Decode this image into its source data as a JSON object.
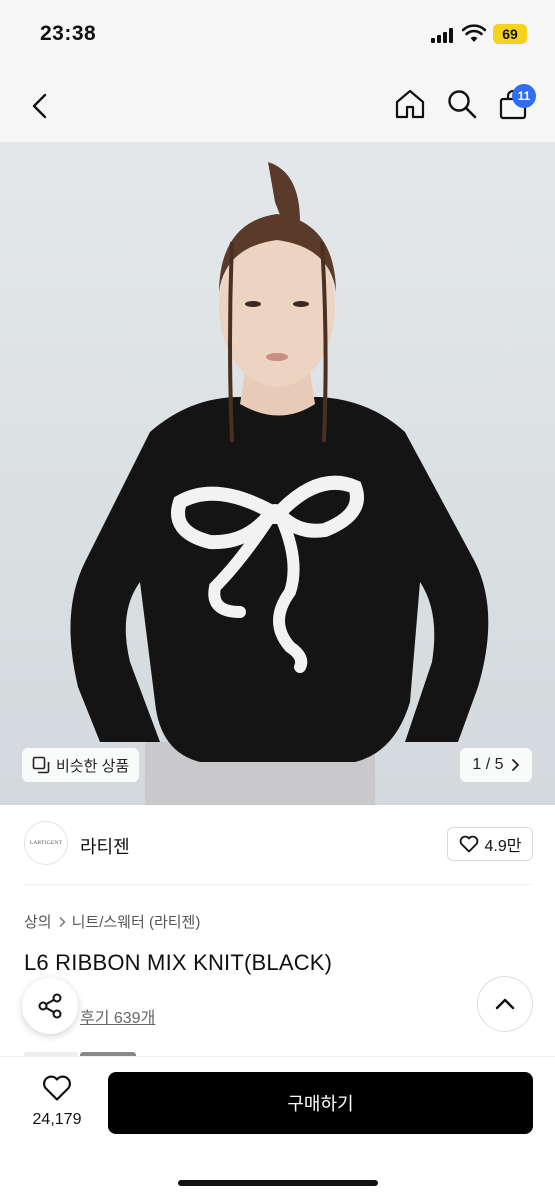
{
  "status_bar": {
    "time": "23:38",
    "battery": "69"
  },
  "nav": {
    "cart_count": "11"
  },
  "hero": {
    "similar_label": "비슷한 상품",
    "pager": "1 / 5"
  },
  "brand": {
    "logo_text": "LARTIGENT",
    "name": "라티젠",
    "likes": "4.9만"
  },
  "breadcrumb": {
    "level1": "상의",
    "level2": "니트/스웨터 (라티젠)"
  },
  "product": {
    "title": "L6 RIBBON MIX KNIT(BLACK)",
    "reviews": "후기 639개"
  },
  "bottom_bar": {
    "wish_count": "24,179",
    "buy_label": "구매하기"
  },
  "colors": {
    "accent": "#2f6df3",
    "battery": "#f5d21c",
    "buy_button": "#000000"
  }
}
